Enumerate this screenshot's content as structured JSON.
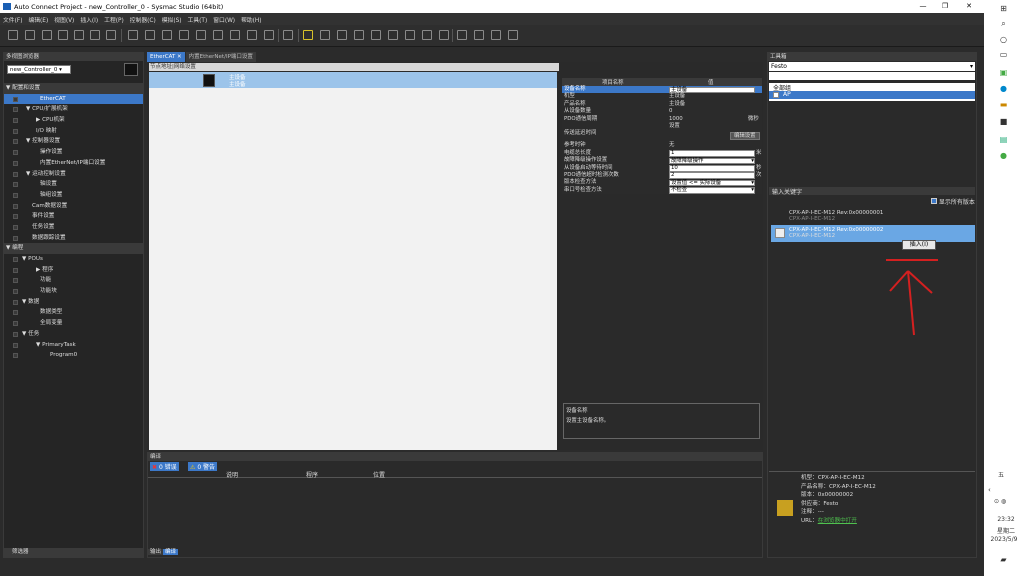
{
  "window": {
    "title": "Auto Connect Project - new_Controller_0 - Sysmac Studio (64bit)"
  },
  "menu": [
    "文件(F)",
    "编辑(E)",
    "视图(V)",
    "插入(I)",
    "工程(P)",
    "控制器(C)",
    "模拟(S)",
    "工具(T)",
    "窗口(W)",
    "帮助(H)"
  ],
  "left_panel": {
    "title": "多视图浏览器",
    "controller": "new_Controller_0",
    "section_config": "配置和设置",
    "config_items": [
      "EtherCAT",
      "CPU/扩展机架",
      "CPU机架",
      "I/O 映射",
      "控制器设置",
      "操作设置",
      "内置EtherNet/IP端口设置",
      "运动控制设置",
      "轴设置",
      "轴组设置",
      "Cam数据设置",
      "事件设置",
      "任务设置",
      "数据跟踪设置"
    ],
    "section_program": "编程",
    "program_items": [
      "POUs",
      "程序",
      "功能",
      "功能块",
      "数据",
      "数据类型",
      "全局变量",
      "任务",
      "PrimaryTask",
      "Program0"
    ],
    "footer": "筛选器"
  },
  "tabs": [
    "EtherCAT",
    "内置EtherNet/IP端口设置"
  ],
  "canvas": {
    "header_tab": "节点地址|网络设置",
    "master_label": "主设备",
    "master_sublabel": "主设备"
  },
  "properties": {
    "header_name": "项目名称",
    "header_value": "值",
    "rows": [
      {
        "name": "设备名称",
        "value": "主设备"
      },
      {
        "name": "机型",
        "value": "主设备"
      },
      {
        "name": "产品名称",
        "value": "主设备"
      },
      {
        "name": "从设备数量",
        "value": "0"
      },
      {
        "name": "PDO通信周期",
        "value": "1000"
      },
      {
        "name": "",
        "value": "设置"
      },
      {
        "name": "传送延迟时间",
        "value": ""
      },
      {
        "name": "参考时钟",
        "value": "无"
      },
      {
        "name": "电缆总长度",
        "value": "1"
      },
      {
        "name": "故障降级操作设置",
        "value": "故障降级操作"
      },
      {
        "name": "从设备启动等待时间",
        "value": "10"
      },
      {
        "name": "PDO通信超时检测次数",
        "value": "2"
      },
      {
        "name": "版本检查方法",
        "value": "设置值 <= 实际设备"
      },
      {
        "name": "串口号检查方法",
        "value": "不检查"
      }
    ],
    "pdo_unit": "微秒",
    "edit_button": "编辑设置",
    "len_unit": "米",
    "time_unit": "秒",
    "count_unit": "次",
    "desc_title": "设备名称",
    "desc_text": "设置主设备名称。"
  },
  "bottom": {
    "title": "编译",
    "errors_badge": "0 错误",
    "warnings_badge": "0 警告",
    "columns": [
      "说明",
      "程序",
      "位置"
    ],
    "tab_output": "输出",
    "tab_build": "编译"
  },
  "right": {
    "title": "工具箱",
    "vendor": "Festo",
    "search_value": "",
    "group_all": "全部组",
    "group_ap": "AP",
    "keyword_placeholder": "输入关键字",
    "show_all_versions": "显示所有版本",
    "devices": [
      {
        "name": "CPX-AP-I-EC-M12 Rev:0x00000001",
        "sub": "CPX-AP-I-EC-M12"
      },
      {
        "name": "CPX-AP-I-EC-M12 Rev:0x00000002",
        "sub": "CPX-AP-I-EC-M12"
      }
    ],
    "insert_button": "插入(I)",
    "info_model": "机型：CPX-AP-I-EC-M12",
    "info_product": "产品名称：CPX-AP-I-EC-M12",
    "info_version": "版本：0x00000002",
    "info_vendor": "供应商：Festo",
    "info_note": "注释：---",
    "info_url_label": "URL：",
    "info_url_link": "在浏览器中打开"
  },
  "taskbar": {
    "time": "23:32",
    "weekday": "星期二",
    "date": "2023/5/9",
    "ime": "五"
  },
  "colors": {
    "accent": "#3c78c8",
    "annotation": "#d42020"
  }
}
